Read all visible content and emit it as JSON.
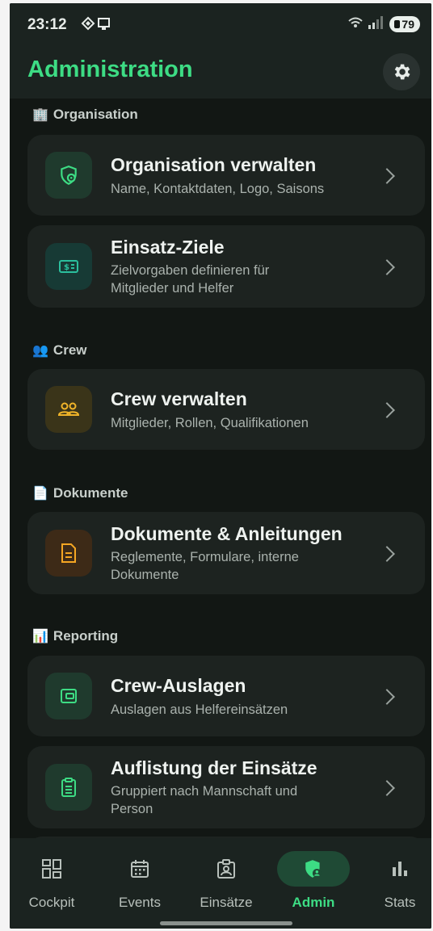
{
  "status_bar": {
    "time": "23:12",
    "battery": "79"
  },
  "app_bar": {
    "title": "Administration",
    "settings_icon": "gear-icon"
  },
  "sections": [
    {
      "emoji": "🏢",
      "label": "Organisation",
      "items": [
        {
          "title": "Organisation verwalten",
          "subtitle": "Name, Kontaktdaten, Logo, Saisons",
          "icon": "shield-gear-icon",
          "color": "#3ddc84"
        },
        {
          "title": "Einsatz-Ziele",
          "subtitle": "Zielvorgaben definieren für Mitglieder und Helfer",
          "icon": "money-target-icon",
          "color": "#2bbf9d"
        }
      ]
    },
    {
      "emoji": "👥",
      "label": "Crew",
      "items": [
        {
          "title": "Crew verwalten",
          "subtitle": "Mitglieder, Rollen, Qualifikationen",
          "icon": "people-icon",
          "color": "#f0b429"
        }
      ]
    },
    {
      "emoji": "📄",
      "label": "Dokumente",
      "items": [
        {
          "title": "Dokumente & Anleitungen",
          "subtitle": "Reglemente, Formulare, interne Dokumente",
          "icon": "document-icon",
          "color": "#f5a623"
        }
      ]
    },
    {
      "emoji": "📊",
      "label": "Reporting",
      "items": [
        {
          "title": "Crew-Auslagen",
          "subtitle": "Auslagen aus Helfereinsätzen",
          "icon": "wallet-icon",
          "color": "#3ddc84"
        },
        {
          "title": "Auflistung der Einsätze",
          "subtitle": "Gruppiert nach Mannschaft und Person",
          "icon": "clipboard-list-icon",
          "color": "#3ddc84"
        }
      ]
    }
  ],
  "bottom_nav": [
    {
      "label": "Cockpit",
      "icon": "dashboard-icon",
      "active": false
    },
    {
      "label": "Events",
      "icon": "calendar-icon",
      "active": false
    },
    {
      "label": "Einsätze",
      "icon": "badge-icon",
      "active": false
    },
    {
      "label": "Admin",
      "icon": "shield-admin-icon",
      "active": true
    },
    {
      "label": "Stats",
      "icon": "bar-chart-icon",
      "active": false
    }
  ],
  "colors": {
    "accent": "#3ddc84",
    "background": "#121714",
    "card": "#1d2320"
  }
}
